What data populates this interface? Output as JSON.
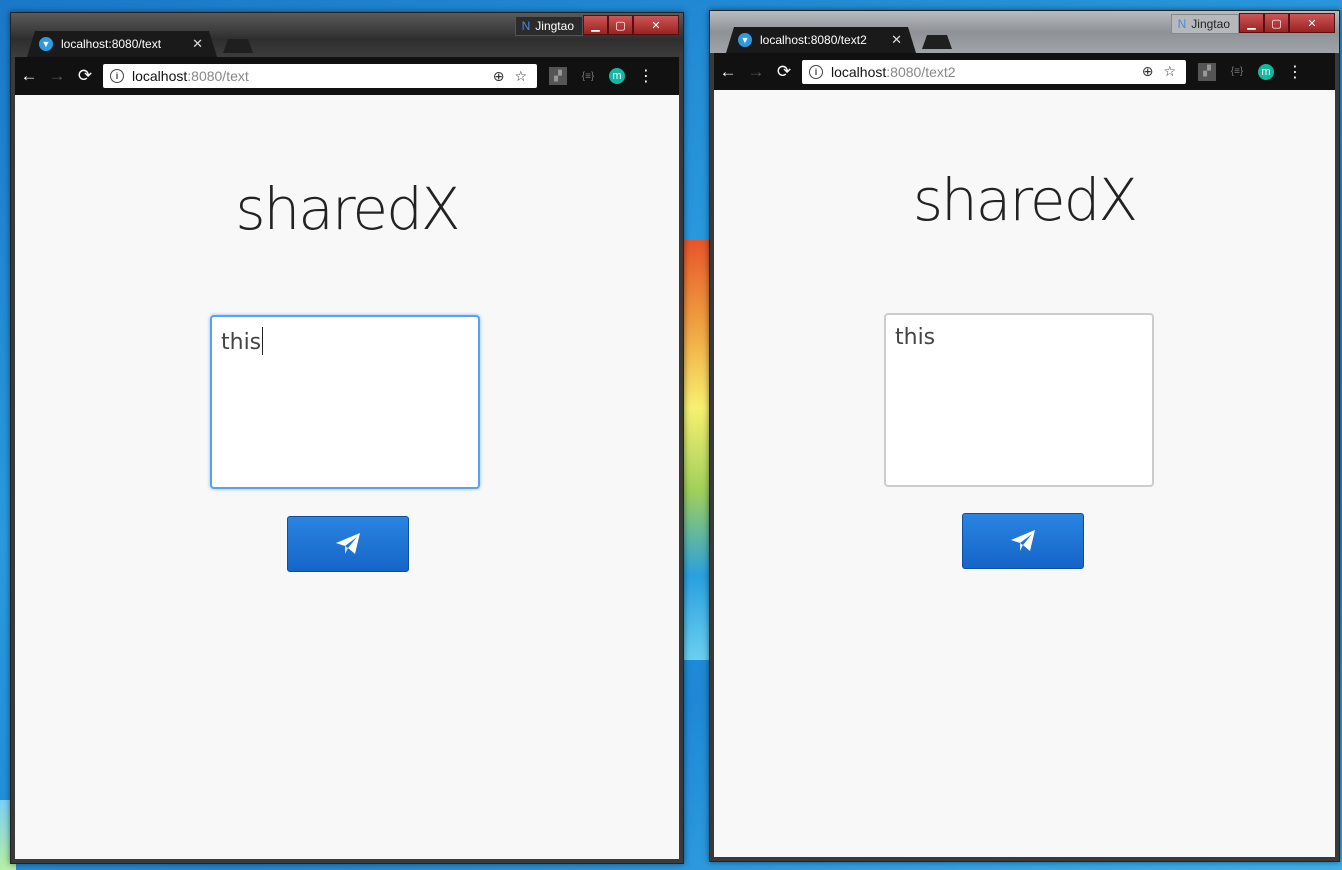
{
  "windows": [
    {
      "profile": "Jingtao",
      "tab_title": "localhost:8080/text",
      "url_host": "localhost",
      "url_rest": ":8080/text",
      "heading": "sharedX",
      "textarea_value": "this"
    },
    {
      "profile": "Jingtao",
      "tab_title": "localhost:8080/text2",
      "url_host": "localhost",
      "url_rest": ":8080/text2",
      "heading": "sharedX",
      "textarea_value": "this"
    }
  ],
  "icons": {
    "back": "←",
    "forward": "→",
    "reload": "⟳",
    "tab_close": "✕",
    "zoom": "⊕",
    "star": "☆",
    "json_ext": "{≡}",
    "m_ext": "m",
    "menu": "⋮",
    "minimize": "▁",
    "maximize": "▢",
    "close": "✕",
    "send": "paper-plane-icon"
  },
  "colors": {
    "accent": "#1a72d6",
    "focus_border": "#5aa0f0"
  }
}
